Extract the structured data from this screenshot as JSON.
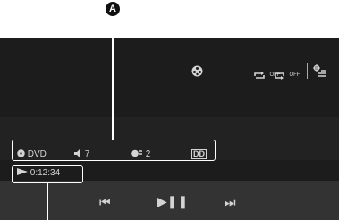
{
  "callouts": {
    "a": "A"
  },
  "top_controls": {
    "angle_icon": "angle-icon",
    "repeat_label": "OFF",
    "shuffle_label": "OFF",
    "menu_icon": "settings-menu-icon"
  },
  "info_bar": {
    "media": "DVD",
    "audio_track": "7",
    "subtitle": "2",
    "audio_format": "DD"
  },
  "status": {
    "elapsed": "0:12:34"
  },
  "transport": {
    "prev": "⏮",
    "play_pause": "▶❚❚",
    "next": "⏭"
  }
}
